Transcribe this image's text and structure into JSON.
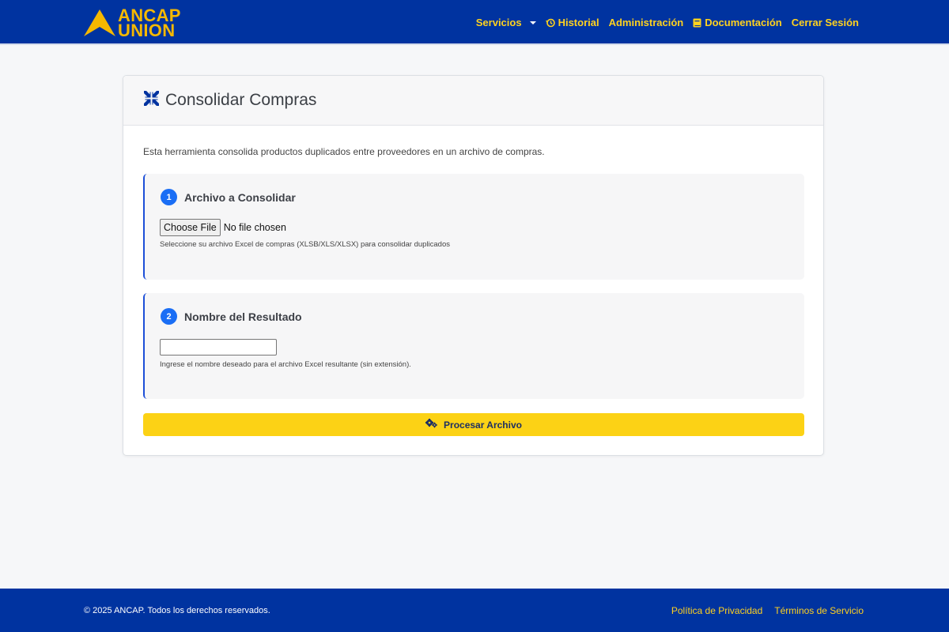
{
  "header": {
    "brand_line1": "ANCAP",
    "brand_line2": "UNION",
    "nav": {
      "servicios": "Servicios",
      "historial": "Historial",
      "administracion": "Administración",
      "documentacion": "Documentación",
      "cerrar_sesion": "Cerrar Sesión"
    },
    "icons": {
      "logo": "ancap-triangle-logo",
      "historial": "history-icon",
      "documentacion": "book-icon"
    }
  },
  "card": {
    "title": "Consolidar Compras",
    "title_icon": "compress-arrows-icon",
    "intro": "Esta herramienta consolida productos duplicados entre proveedores en un archivo de compras.",
    "step1": {
      "number": "1",
      "title": "Archivo a Consolidar",
      "file_button": "Choose File",
      "file_status": "No file chosen",
      "help": "Seleccione su archivo Excel de compras (XLSB/XLS/XLSX) para consolidar duplicados"
    },
    "step2": {
      "number": "2",
      "title": "Nombre del Resultado",
      "input_value": "",
      "help": "Ingrese el nombre deseado para el archivo Excel resultante (sin extensión)."
    },
    "submit": {
      "label": "Procesar Archivo",
      "icon": "gears-icon"
    }
  },
  "footer": {
    "copyright": "© 2025 ANCAP. Todos los derechos reservados.",
    "privacy": "Política de Privacidad",
    "terms": "Términos de Servicio"
  },
  "colors": {
    "primary_blue": "#0033a0",
    "accent_yellow": "#fcd215",
    "nav_text": "#ffd21f",
    "step_badge": "#1a6ef5"
  }
}
